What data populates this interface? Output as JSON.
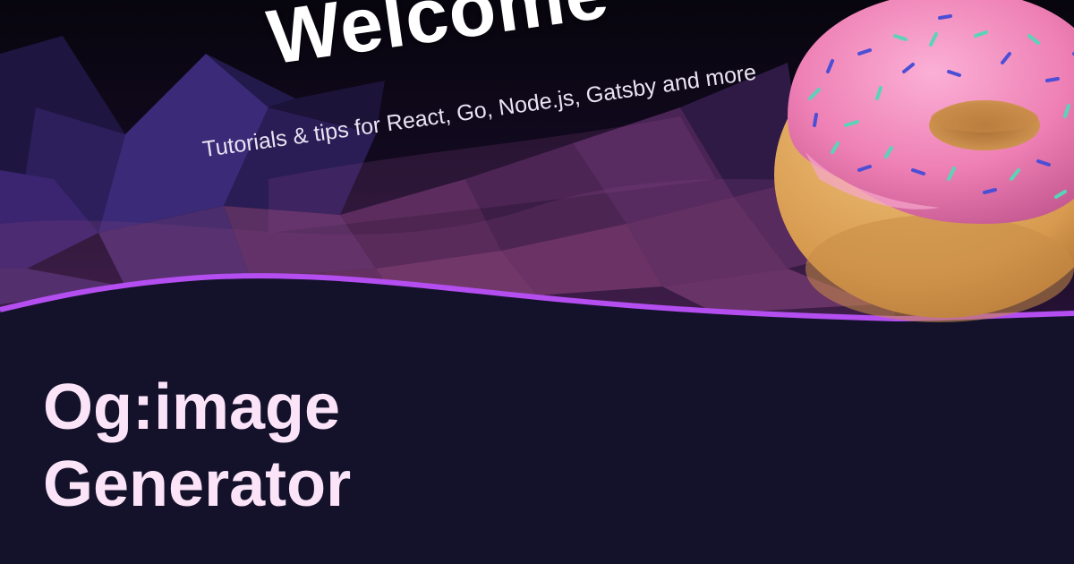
{
  "preview": {
    "heading": "Welcome",
    "tagline": "Tutorials & tips for React, Go, Node.js, Gatsby and more"
  },
  "headline": {
    "line1": "Og:image",
    "line2": "Generator"
  },
  "colors": {
    "background": "#13122a",
    "accent_wave": "#b44ef0",
    "headline_text": "#fbe3f8",
    "frosting": "#ef84b7",
    "dough": "#e0a860"
  },
  "icons": {
    "hero_decoration": "donut-icon",
    "background_art": "low-poly-mountains"
  }
}
